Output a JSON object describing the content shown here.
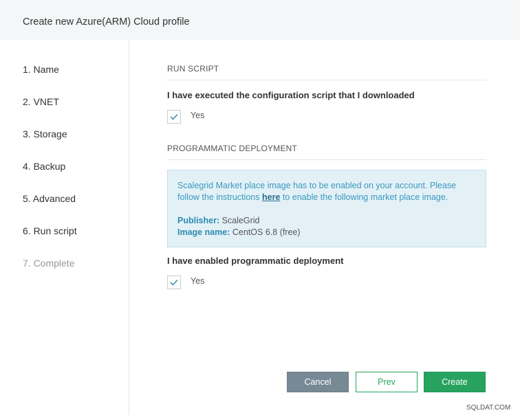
{
  "header": {
    "title": "Create new Azure(ARM) Cloud profile"
  },
  "sidebar": {
    "steps": [
      {
        "label": "1. Name"
      },
      {
        "label": "2. VNET"
      },
      {
        "label": "3. Storage"
      },
      {
        "label": "4. Backup"
      },
      {
        "label": "5. Advanced"
      },
      {
        "label": "6. Run script"
      },
      {
        "label": "7. Complete"
      }
    ]
  },
  "run_script": {
    "heading": "RUN SCRIPT",
    "question": "I have executed the configuration script that I downloaded",
    "checkbox_label": "Yes",
    "checked": true
  },
  "programmatic": {
    "heading": "PROGRAMMATIC DEPLOYMENT",
    "info_text_before": "Scalegrid Market place image has to be enabled on your account. Please follow the instructions ",
    "info_link": "here",
    "info_text_after": " to enable the following market place image.",
    "publisher_label": "Publisher:",
    "publisher_value": "ScaleGrid",
    "image_label": "Image name:",
    "image_value": "CentOS 6.8 (free)",
    "question": "I have enabled programmatic deployment",
    "checkbox_label": "Yes",
    "checked": true
  },
  "buttons": {
    "cancel": "Cancel",
    "prev": "Prev",
    "create": "Create"
  },
  "watermark": "SQLDAT.COM",
  "colors": {
    "accent_green": "#27a35f",
    "cancel_gray": "#778995",
    "info_bg": "#e3f1f7",
    "info_text": "#3a98bd"
  }
}
